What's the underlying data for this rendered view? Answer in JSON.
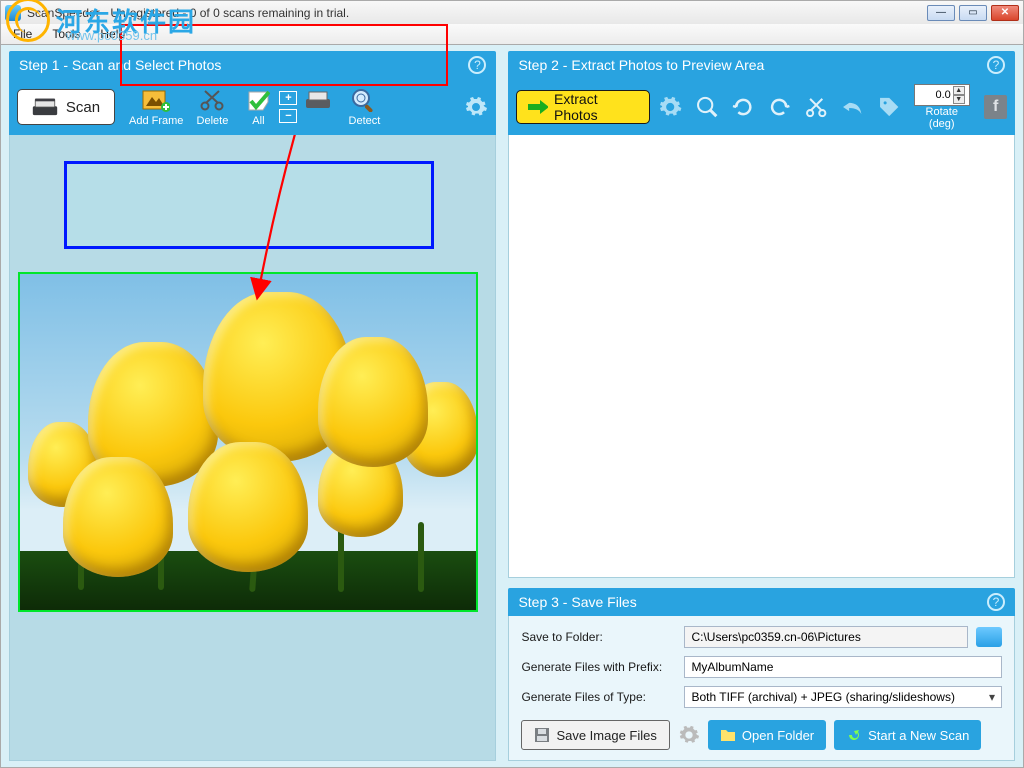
{
  "window": {
    "title": "ScanSpeeder - Unregistered - 0 of 0 scans remaining in trial."
  },
  "menu": {
    "file": "File",
    "tools": "Tools",
    "help": "Help"
  },
  "watermark": {
    "text": "河东软件园",
    "url": "www.pc0359.cn"
  },
  "step1": {
    "title": "Step 1 - Scan and Select Photos",
    "scan": "Scan",
    "add_frame": "Add Frame",
    "delete": "Delete",
    "all": "All",
    "detect": "Detect"
  },
  "step2": {
    "title": "Step 2 - Extract Photos to Preview Area",
    "extract": "Extract Photos",
    "rotate_value": "0.0",
    "rotate_label": "Rotate (deg)"
  },
  "step3": {
    "title": "Step 3 - Save Files",
    "save_to_folder": "Save to Folder:",
    "folder_path": "C:\\Users\\pc0359.cn-06\\Pictures",
    "prefix_label": "Generate Files with Prefix:",
    "prefix_value": "MyAlbumName",
    "type_label": "Generate Files of Type:",
    "type_value": "Both TIFF (archival) + JPEG (sharing/slideshows)",
    "save_btn": "Save Image Files",
    "open_folder": "Open Folder",
    "new_scan": "Start a New Scan"
  }
}
